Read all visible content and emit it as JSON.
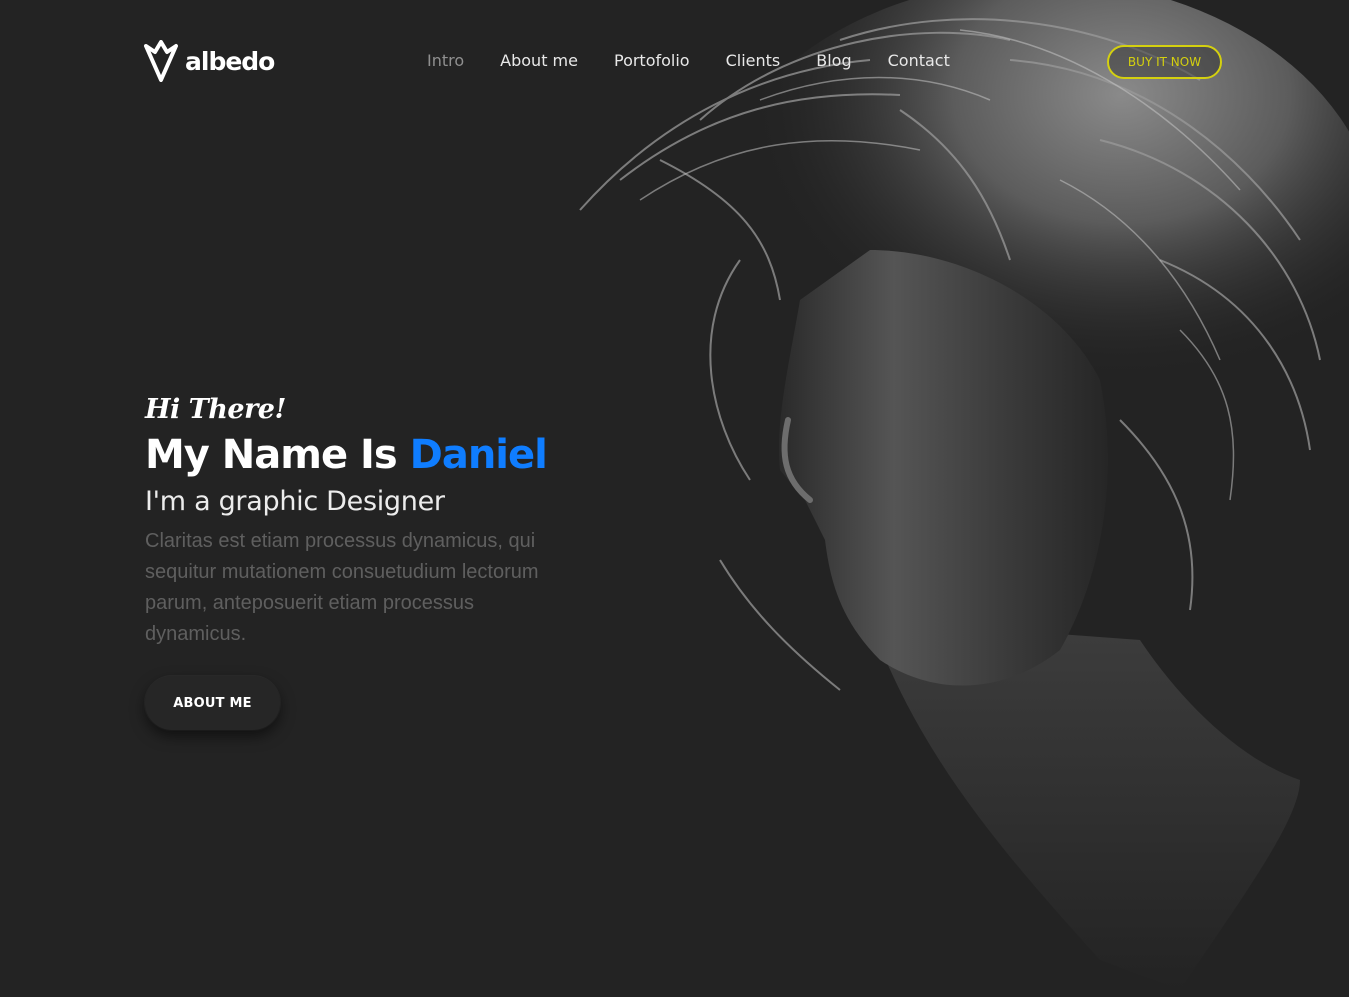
{
  "brand": {
    "name": "albedo",
    "icon": "diamond-heart-icon"
  },
  "nav": {
    "items": [
      {
        "label": "Intro",
        "active": true
      },
      {
        "label": "About me",
        "active": false
      },
      {
        "label": "Portofolio",
        "active": false
      },
      {
        "label": "Clients",
        "active": false
      },
      {
        "label": "Blog",
        "active": false
      },
      {
        "label": "Contact",
        "active": false
      }
    ],
    "cta_label": "BUY IT NOW"
  },
  "hero": {
    "greeting": "Hi There!",
    "headline_prefix": "My Name Is ",
    "headline_name": "Daniel",
    "subtitle": "I'm a graphic Designer",
    "description": "Claritas est etiam processus dynamicus, qui sequitur mutationem consuetudium lectorum parum, anteposuerit etiam processus dynamicus.",
    "button_label": "ABOUT ME"
  },
  "colors": {
    "background": "#232323",
    "accent": "#0f7dff",
    "cta": "#d4d00f",
    "muted_text": "#5f5f5f"
  },
  "image": {
    "subject": "portrait-photo"
  }
}
